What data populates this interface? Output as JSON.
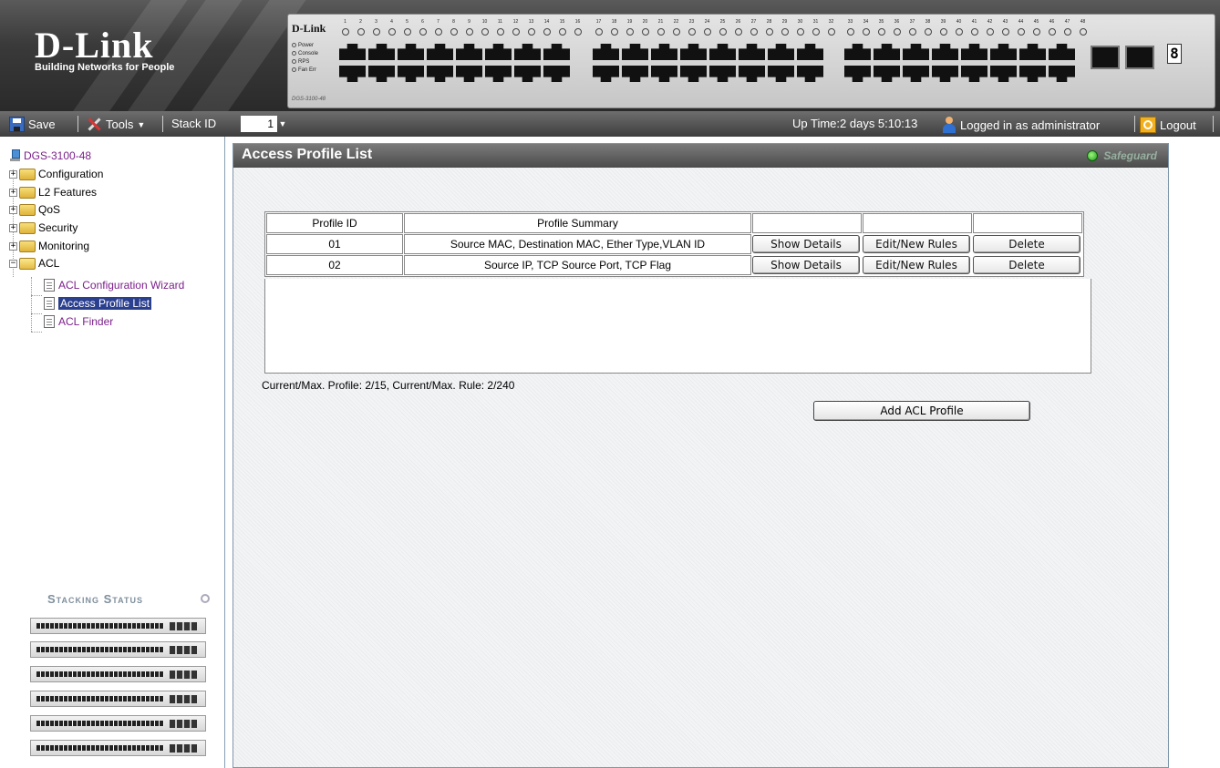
{
  "banner": {
    "logo": "D-Link",
    "tagline": "Building Networks for People",
    "switch_brand": "D-Link",
    "switch_model": "DGS-3100-48",
    "status_leds": [
      "Power",
      "Console",
      "RPS",
      "Fan Err"
    ],
    "port_groups": [
      [
        "1",
        "2",
        "3",
        "4",
        "5",
        "6",
        "7",
        "8",
        "9",
        "10",
        "11",
        "12",
        "13",
        "14",
        "15",
        "16"
      ],
      [
        "17",
        "18",
        "19",
        "20",
        "21",
        "22",
        "23",
        "24",
        "25",
        "26",
        "27",
        "28",
        "29",
        "30",
        "31",
        "32"
      ],
      [
        "33",
        "34",
        "35",
        "36",
        "37",
        "38",
        "39",
        "40",
        "41",
        "42",
        "43",
        "44",
        "45",
        "46",
        "47",
        "48"
      ]
    ],
    "unit_display": "8"
  },
  "toolbar": {
    "save_label": "Save",
    "tools_label": "Tools",
    "stack_id_label": "Stack ID",
    "stack_id_value": "1",
    "uptime": "Up Time:2 days 5:10:13",
    "logged_in": "Logged in as administrator",
    "logout_label": "Logout"
  },
  "tree": {
    "root": "DGS-3100-48",
    "folders": [
      "Configuration",
      "L2 Features",
      "QoS",
      "Security",
      "Monitoring",
      "ACL"
    ],
    "acl_children": [
      "ACL Configuration Wizard",
      "Access Profile List",
      "ACL Finder"
    ],
    "selected": "Access Profile List"
  },
  "stacking_status": {
    "title": "Stacking Status",
    "unit_count": 6
  },
  "main": {
    "title": "Access Profile List",
    "safeguard_label": "Safeguard",
    "table": {
      "headers": [
        "Profile ID",
        "Profile Summary",
        "",
        "",
        ""
      ],
      "rows": [
        {
          "id": "01",
          "summary": "Source MAC, Destination MAC, Ether Type,VLAN ID",
          "show": "Show Details",
          "edit": "Edit/New Rules",
          "delete": "Delete"
        },
        {
          "id": "02",
          "summary": "Source IP, TCP Source Port, TCP Flag",
          "show": "Show Details",
          "edit": "Edit/New Rules",
          "delete": "Delete"
        }
      ]
    },
    "summary_text": "Current/Max. Profile: 2/15, Current/Max. Rule: 2/240",
    "add_button": "Add ACL Profile"
  },
  "colors": {
    "selected_bg": "#2b3f8f",
    "link_purple": "#7b1f8a",
    "header_gray": "#4b4b4b"
  }
}
